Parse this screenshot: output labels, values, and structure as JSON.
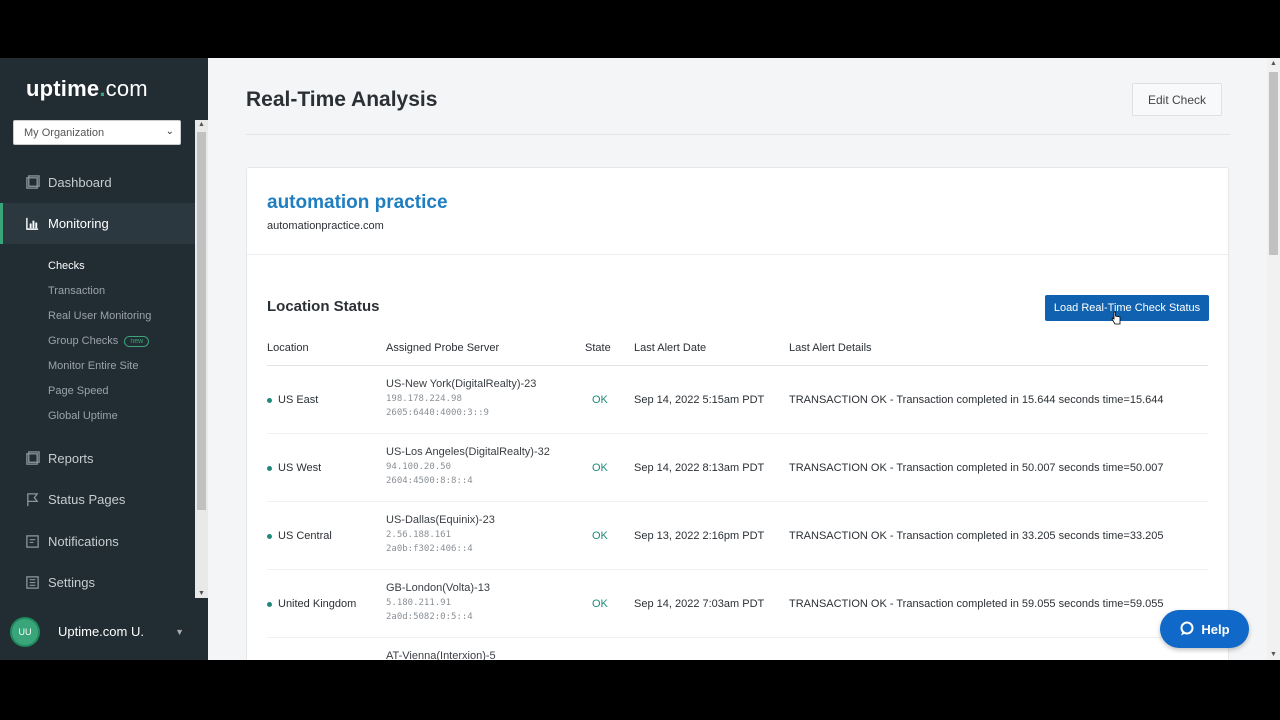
{
  "app": {
    "logo_main": "uptime",
    "logo_dot": ".",
    "logo_com": "com"
  },
  "org_select": {
    "value": "My Organization"
  },
  "nav": {
    "dashboard": "Dashboard",
    "monitoring": "Monitoring",
    "reports": "Reports",
    "status_pages": "Status Pages",
    "notifications": "Notifications",
    "settings": "Settings"
  },
  "subnav": {
    "checks": "Checks",
    "transaction": "Transaction",
    "rum": "Real User Monitoring",
    "group_checks": "Group Checks",
    "group_badge": "new",
    "monitor_site": "Monitor Entire Site",
    "page_speed": "Page Speed",
    "global_uptime": "Global Uptime"
  },
  "user": {
    "initials": "UU",
    "name": "Uptime.com U."
  },
  "page": {
    "title": "Real-Time Analysis",
    "edit_label": "Edit Check"
  },
  "check": {
    "name": "automation practice",
    "url": "automationpractice.com"
  },
  "location_status": {
    "title": "Location Status",
    "load_label": "Load Real-Time Check Status",
    "headers": {
      "location": "Location",
      "probe": "Assigned Probe Server",
      "state": "State",
      "date": "Last Alert Date",
      "details": "Last Alert Details"
    },
    "rows": [
      {
        "location": "US East",
        "probe": "US-New York(DigitalRealty)-23",
        "ipv4": "198.178.224.98",
        "ipv6": "2605:6440:4000:3::9",
        "state": "OK",
        "date": "Sep 14, 2022 5:15am PDT",
        "details": "TRANSACTION OK - Transaction completed in 15.644 seconds time=15.644"
      },
      {
        "location": "US West",
        "probe": "US-Los Angeles(DigitalRealty)-32",
        "ipv4": "94.100.20.50",
        "ipv6": "2604:4500:8:8::4",
        "state": "OK",
        "date": "Sep 14, 2022 8:13am PDT",
        "details": "TRANSACTION OK - Transaction completed in 50.007 seconds time=50.007"
      },
      {
        "location": "US Central",
        "probe": "US-Dallas(Equinix)-23",
        "ipv4": "2.56.188.161",
        "ipv6": "2a0b:f302:406::4",
        "state": "OK",
        "date": "Sep 13, 2022 2:16pm PDT",
        "details": "TRANSACTION OK - Transaction completed in 33.205 seconds time=33.205"
      },
      {
        "location": "United Kingdom",
        "probe": "GB-London(Volta)-13",
        "ipv4": "5.180.211.91",
        "ipv6": "2a0d:5082:0:5::4",
        "state": "OK",
        "date": "Sep 14, 2022 7:03am PDT",
        "details": "TRANSACTION OK - Transaction completed in 59.055 seconds time=59.055"
      },
      {
        "location": "",
        "probe": "AT-Vienna(Interxion)-5",
        "ipv4": "",
        "ipv6": "",
        "state": "",
        "date": "",
        "details": ""
      }
    ]
  },
  "help": {
    "label": "Help"
  },
  "colors": {
    "accent": "#3aa57a",
    "primary_button": "#1062b0",
    "link": "#1e7ec0",
    "sidebar": "#212c33",
    "help": "#1068c9"
  }
}
